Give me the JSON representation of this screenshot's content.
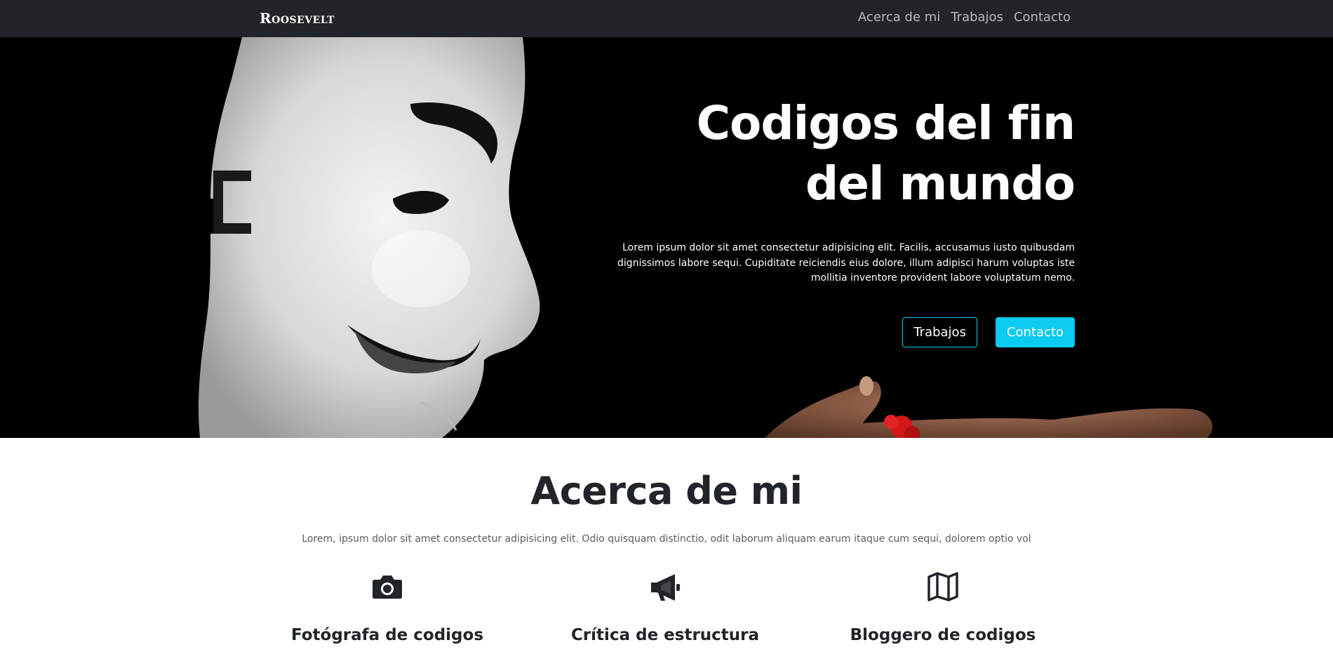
{
  "navbar": {
    "brand": "Roosevelt",
    "links": [
      "Acerca de mi",
      "Trabajos",
      "Contacto"
    ]
  },
  "hero": {
    "title_line1": "Codigos del fin",
    "title_line2": "del mundo",
    "text": "Lorem ipsum dolor sit amet consectetur adipisicing elit. Facilis, accusamus iusto quibusdam dignissimos labore sequi. Cupiditate reiciendis eius dolore, illum adipisci harum voluptas iste mollitia inventore provident labore voluptatum nemo.",
    "button_secondary": "Trabajos",
    "button_primary": "Contacto",
    "image": "mask-photo"
  },
  "about": {
    "title": "Acerca de mi",
    "text": "Lorem, ipsum dolor sit amet consectetur adipisicing elit. Odio quisquam distinctio, odit laborum aliquam earum itaque cum sequi, dolorem optio vol",
    "features": [
      {
        "icon": "camera-icon",
        "title": "Fotógrafa de codigos"
      },
      {
        "icon": "megaphone-icon",
        "title": "Crítica de estructura"
      },
      {
        "icon": "map-icon",
        "title": "Bloggero de codigos"
      }
    ]
  },
  "colors": {
    "navbar_bg": "#212529",
    "accent": "#0dcaf0",
    "hero_bg": "#000000"
  }
}
